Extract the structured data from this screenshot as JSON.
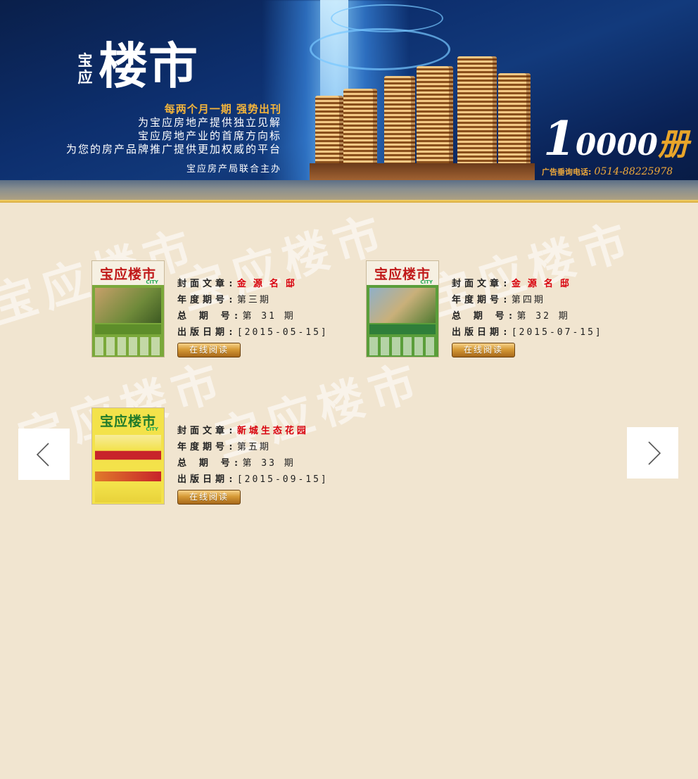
{
  "banner": {
    "logo_vertical": "宝应",
    "logo_main": "楼市",
    "highlight": "每两个月一期  强势出刊",
    "lines": [
      "为宝应房地产提供独立见解",
      "宝应房地产业的首席方向标",
      "为您的房产品牌推广提供更加权威的平台"
    ],
    "sponsor": "宝应房产局联合主办",
    "circulation_big": "1",
    "circulation_rest": "0000",
    "circulation_unit": "册",
    "ad_label": "广告垂询电话:",
    "ad_phone": "0514-88225978"
  },
  "watermark": "宝应楼市",
  "issues": [
    {
      "cover_title": "宝应楼市",
      "cover_city": "CITY",
      "k1": "封面文章:",
      "v1": "金源名邸",
      "k2": "年度期号:",
      "v2": "第三期",
      "k3": "总 期 号:",
      "v3": "第 31 期",
      "k4": "出版日期:",
      "v4": "[2015-05-15]",
      "btn": "在线阅读"
    },
    {
      "cover_title": "宝应楼市",
      "cover_city": "CITY",
      "k1": "封面文章:",
      "v1": "金源名邸",
      "k2": "年度期号:",
      "v2": "第四期",
      "k3": "总 期 号:",
      "v3": "第 32 期",
      "k4": "出版日期:",
      "v4": "[2015-07-15]",
      "btn": "在线阅读"
    },
    {
      "cover_title": "宝应楼市",
      "cover_city": "CITY",
      "k1": "封面文章:",
      "v1": "新城生态花园",
      "k2": "年度期号:",
      "v2": "第五期",
      "k3": "总 期 号:",
      "v3": "第 33 期",
      "k4": "出版日期:",
      "v4": "[2015-09-15]",
      "btn": "在线阅读"
    }
  ],
  "icons": {
    "prev": "chevron-left-icon",
    "next": "chevron-right-icon"
  },
  "colors": {
    "page_bg": "#f1e5d0",
    "accent_red": "#d8000c",
    "gold": "#e9a52a",
    "banner_navy": "#0d2f6e"
  }
}
